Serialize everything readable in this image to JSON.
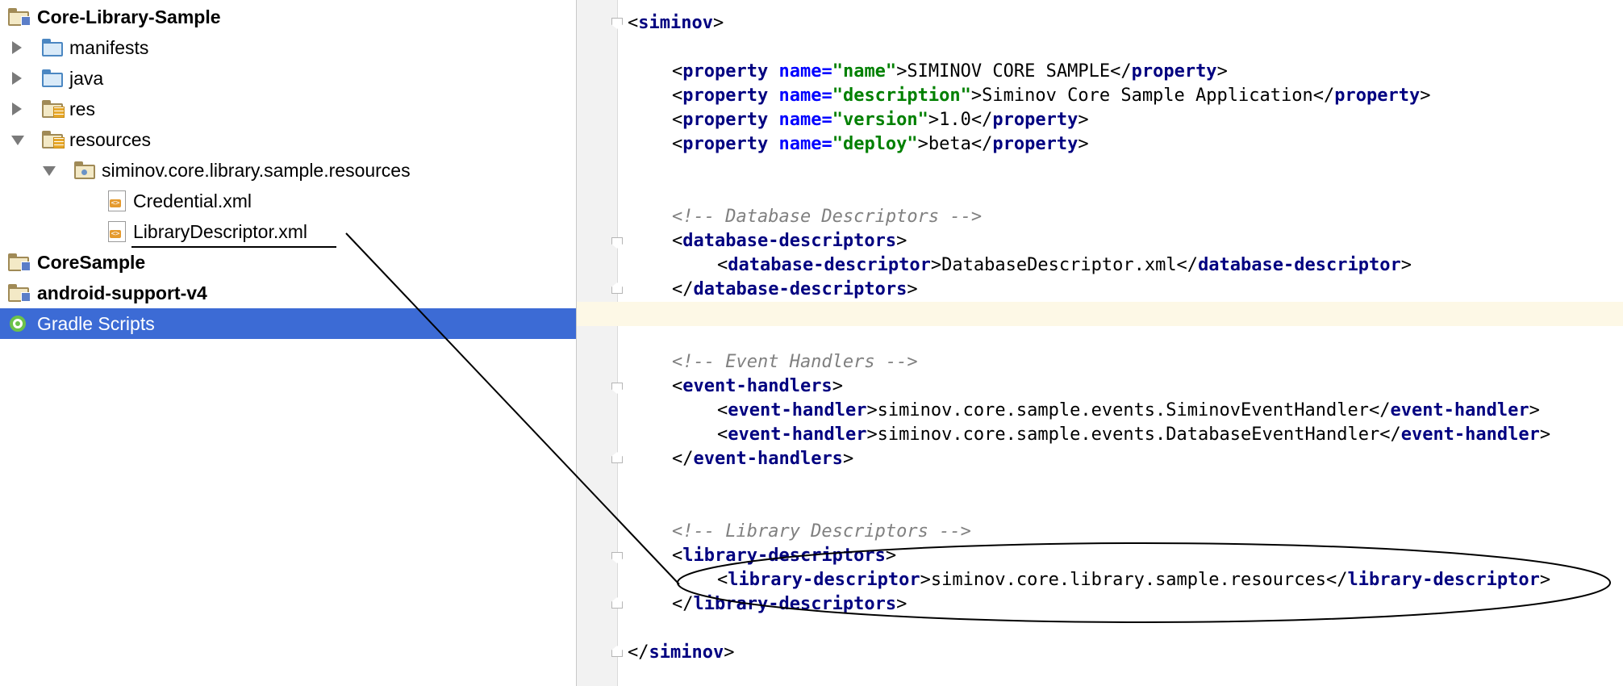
{
  "project_tree": {
    "rows": [
      {
        "label": "Core-Library-Sample"
      },
      {
        "label": "manifests"
      },
      {
        "label": "java"
      },
      {
        "label": "res"
      },
      {
        "label": "resources"
      },
      {
        "label": "siminov.core.library.sample.resources"
      },
      {
        "label": "Credential.xml"
      },
      {
        "label": "LibraryDescriptor.xml"
      },
      {
        "label": "CoreSample"
      },
      {
        "label": "android-support-v4"
      },
      {
        "label": "Gradle Scripts"
      }
    ],
    "selected_row": "Gradle Scripts",
    "selection_color": "#3c6bd5"
  },
  "editor": {
    "caret_line_color": "#fdf8e6",
    "lines": {
      "root_open": {
        "lt": "<",
        "tag": "siminov",
        "gt": ">"
      },
      "prop_name": {
        "lt": "<",
        "tag": "property",
        "attr": "name=",
        "val": "\"name\"",
        "text": ">SIMINOV CORE SAMPLE</",
        "ctag": "property",
        "gt": ">"
      },
      "prop_description": {
        "lt": "<",
        "tag": "property",
        "attr": "name=",
        "val": "\"description\"",
        "text": ">Siminov Core Sample Application</",
        "ctag": "property",
        "gt": ">"
      },
      "prop_version": {
        "lt": "<",
        "tag": "property",
        "attr": "name=",
        "val": "\"version\"",
        "text": ">1.0</",
        "ctag": "property",
        "gt": ">"
      },
      "prop_deploy": {
        "lt": "<",
        "tag": "property",
        "attr": "name=",
        "val": "\"deploy\"",
        "text": ">beta</",
        "ctag": "property",
        "gt": ">"
      },
      "comment_db": "<!-- Database Descriptors -->",
      "db_open": {
        "lt": "<",
        "tag": "database-descriptors",
        "gt": ">"
      },
      "db_item": {
        "lt": "<",
        "tag": "database-descriptor",
        "text": ">DatabaseDescriptor.xml</",
        "ctag": "database-descriptor",
        "gt": ">"
      },
      "db_close": {
        "lt": "</",
        "tag": "database-descriptors",
        "gt": ">"
      },
      "comment_events": "<!-- Event Handlers -->",
      "ev_open": {
        "lt": "<",
        "tag": "event-handlers",
        "gt": ">"
      },
      "ev_item1": {
        "lt": "<",
        "tag": "event-handler",
        "text": ">siminov.core.sample.events.SiminovEventHandler</",
        "ctag": "event-handler",
        "gt": ">"
      },
      "ev_item2": {
        "lt": "<",
        "tag": "event-handler",
        "text": ">siminov.core.sample.events.DatabaseEventHandler</",
        "ctag": "event-handler",
        "gt": ">"
      },
      "ev_close": {
        "lt": "</",
        "tag": "event-handlers",
        "gt": ">"
      },
      "comment_lib": "<!-- Library Descriptors -->",
      "lib_open": {
        "lt": "<",
        "tag": "library-descriptors",
        "gt": ">"
      },
      "lib_item": {
        "lt": "<",
        "tag": "library-descriptor",
        "text": ">siminov.core.library.sample.resources</",
        "ctag": "library-descriptor",
        "gt": ">"
      },
      "lib_close": {
        "lt": "</",
        "tag": "library-descriptors",
        "gt": ">"
      },
      "root_close": {
        "lt": "</",
        "tag": "siminov",
        "gt": ">"
      }
    }
  },
  "colors": {
    "tag": "#000080",
    "attribute": "#0000ff",
    "value": "#008000",
    "comment": "#808080",
    "annotation_stroke": "#000000"
  }
}
